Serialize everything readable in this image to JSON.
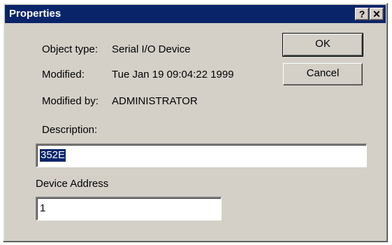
{
  "window": {
    "title": "Properties",
    "help_glyph": "?",
    "close_glyph": "✕"
  },
  "properties": {
    "object_type_label": "Object type:",
    "object_type_value": "Serial I/O Device",
    "modified_label": "Modified:",
    "modified_value": "Tue Jan 19 09:04:22 1999",
    "modified_by_label": "Modified by:",
    "modified_by_value": "ADMINISTRATOR"
  },
  "buttons": {
    "ok_label": "OK",
    "cancel_label": "Cancel"
  },
  "description": {
    "label": "Description:",
    "value": "352E"
  },
  "device_address": {
    "label": "Device Address",
    "value": "1"
  },
  "colors": {
    "titlebar": "#0a246a",
    "dialog_face": "#d4d0c8",
    "selection": "#0a246a"
  }
}
